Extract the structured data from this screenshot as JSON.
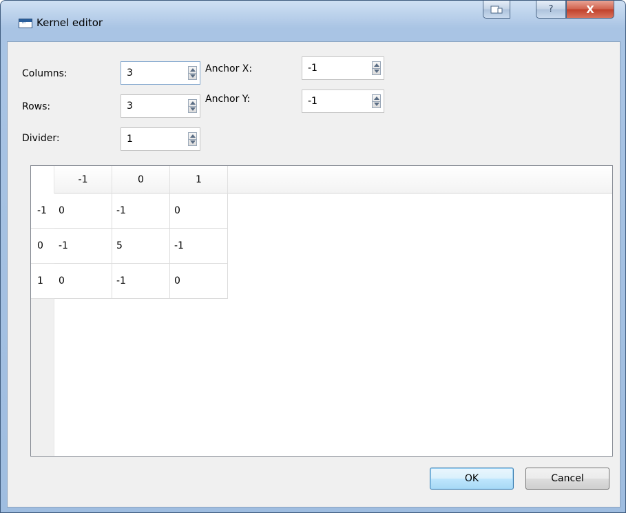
{
  "window": {
    "title": "Kernel editor"
  },
  "caption_buttons": {
    "help": "?",
    "close": "X"
  },
  "fields": {
    "columns": {
      "label": "Columns:",
      "value": "3"
    },
    "rows": {
      "label": "Rows:",
      "value": "3"
    },
    "divider": {
      "label": "Divider:",
      "value": "1"
    },
    "anchor_x": {
      "label": "Anchor X:",
      "value": "-1"
    },
    "anchor_y": {
      "label": "Anchor Y:",
      "value": "-1"
    }
  },
  "grid": {
    "column_headers": [
      "-1",
      "0",
      "1"
    ],
    "row_headers": [
      "-1",
      "0",
      "1"
    ],
    "cells": [
      [
        "0",
        "-1",
        "0"
      ],
      [
        "-1",
        "5",
        "-1"
      ],
      [
        "0",
        "-1",
        "0"
      ]
    ]
  },
  "buttons": {
    "ok": "OK",
    "cancel": "Cancel"
  }
}
